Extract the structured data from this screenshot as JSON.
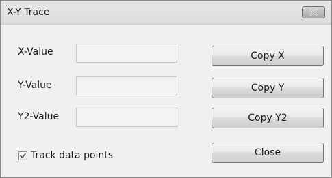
{
  "window": {
    "title": "X-Y Trace"
  },
  "fields": {
    "x_label": "X-Value",
    "x_value": "",
    "y_label": "Y-Value",
    "y_value": "",
    "y2_label": "Y2-Value",
    "y2_value": ""
  },
  "buttons": {
    "copy_x": "Copy X",
    "copy_y": "Copy Y",
    "copy_y2": "Copy Y2",
    "close": "Close"
  },
  "options": {
    "track_label": "Track data points",
    "track_checked": true
  },
  "icons": {
    "title_close": "close-icon",
    "check": "checkmark-icon"
  }
}
